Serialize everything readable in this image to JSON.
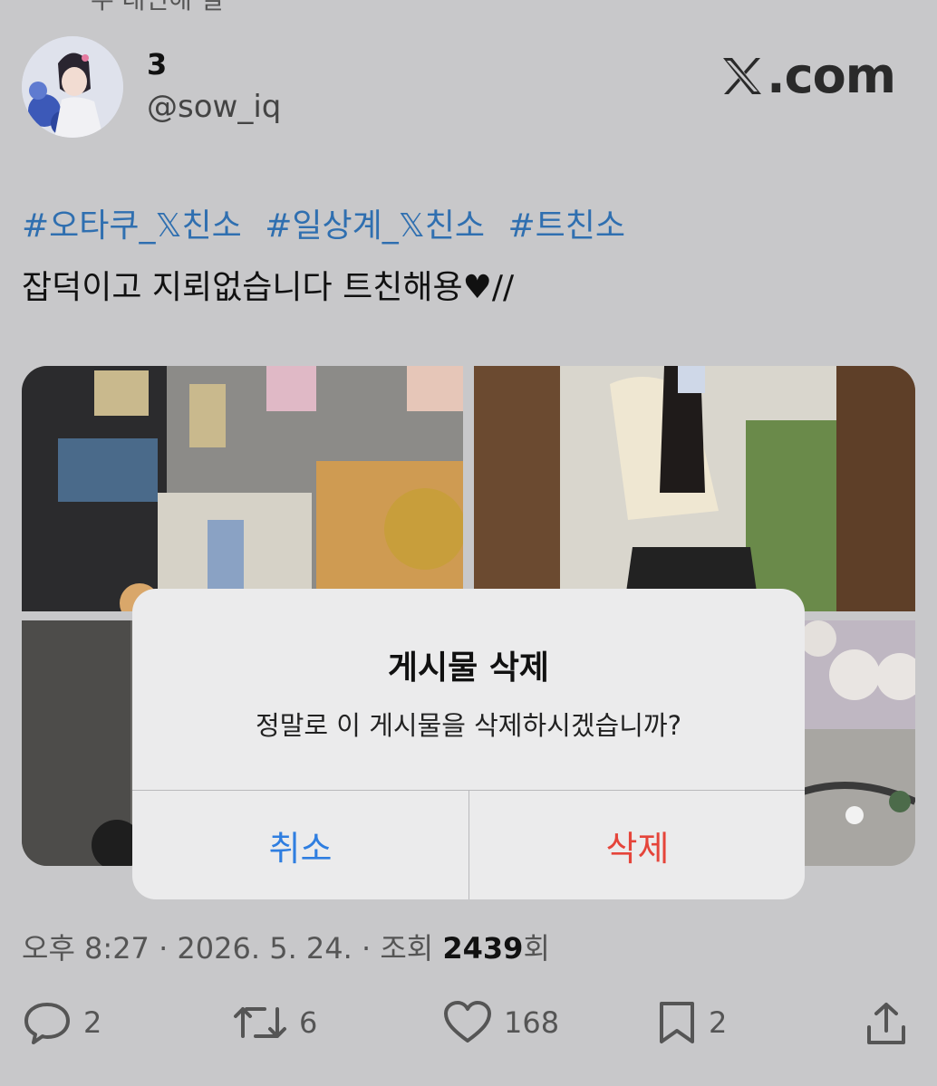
{
  "top_cut_text": "주 대인해 일",
  "author": {
    "display_name": "3",
    "handle": "@sow_iq"
  },
  "brand": {
    "text": ".com",
    "logo_icon": "x-logo-icon"
  },
  "hashtags": [
    "#오타쿠_𝕏친소",
    "#일상계_𝕏친소",
    "#트친소"
  ],
  "body_text": "잡덕이고 지뢰없습니다 트친해용♥//",
  "images": [
    {
      "description_icon": "photo-figure-shelf"
    },
    {
      "description_icon": "photo-selfie-mirror"
    },
    {
      "description_icon": "photo-dark-room"
    },
    {
      "description_icon": "photo-stickers-keychain"
    }
  ],
  "meta": {
    "time_date": "오후 8:27 · 2026. 5. 24. · 조회 ",
    "views": "2439",
    "views_suffix": "회"
  },
  "actions": {
    "replies": "2",
    "reposts": "6",
    "likes": "168",
    "bookmarks": "2"
  },
  "dialog": {
    "title": "게시물 삭제",
    "message": "정말로 이 게시물을 삭제하시겠습니까?",
    "cancel_label": "취소",
    "delete_label": "삭제"
  },
  "colors": {
    "background": "#c8c8ca",
    "hashtag": "#2f6fb0",
    "cancel": "#2f7ee0",
    "delete": "#e5443a",
    "dialog_bg": "#ebebec"
  }
}
